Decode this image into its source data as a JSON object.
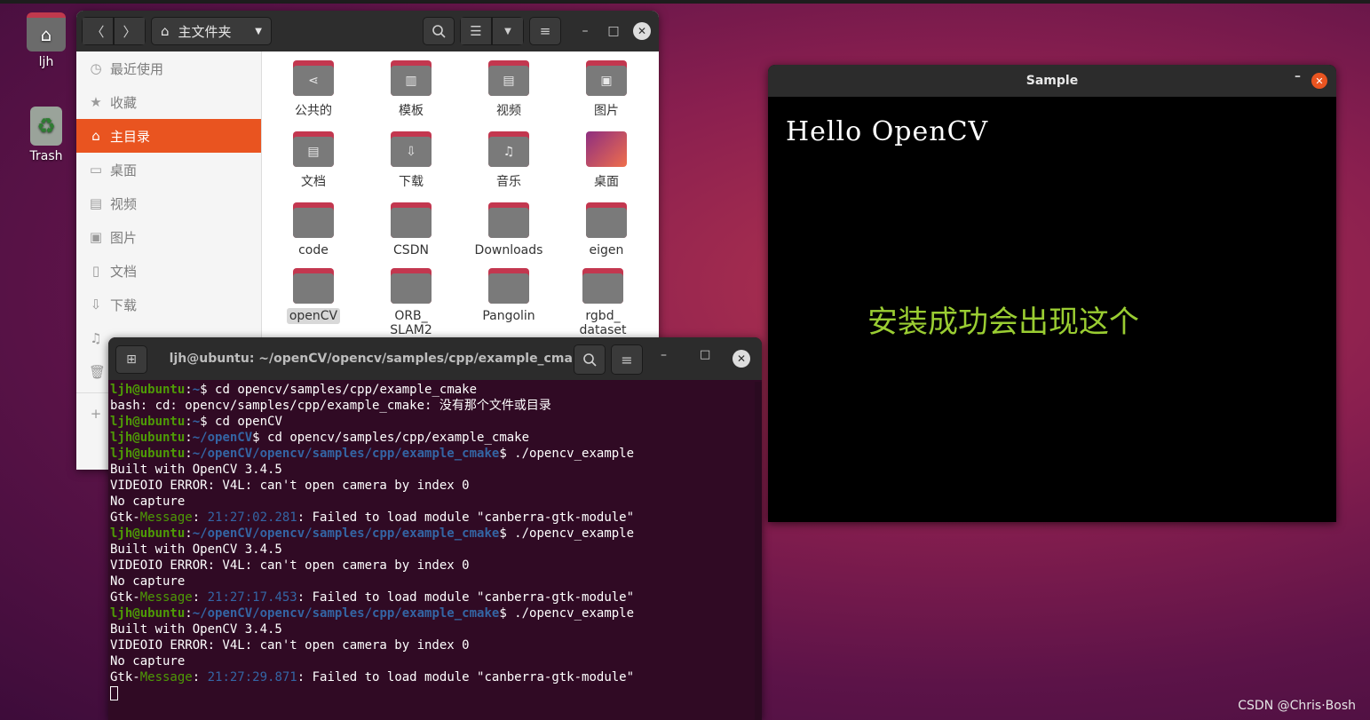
{
  "desktop": {
    "home_label": "ljh",
    "trash_label": "Trash"
  },
  "files": {
    "path_label": "主文件夹",
    "sidebar": [
      {
        "label": "最近使用",
        "icon": "clock-icon"
      },
      {
        "label": "收藏",
        "icon": "star-icon"
      },
      {
        "label": "主目录",
        "icon": "home-icon",
        "active": true
      },
      {
        "label": "桌面",
        "icon": "desktop-icon"
      },
      {
        "label": "视频",
        "icon": "video-icon"
      },
      {
        "label": "图片",
        "icon": "image-icon"
      },
      {
        "label": "文档",
        "icon": "document-icon"
      },
      {
        "label": "下载",
        "icon": "download-icon"
      }
    ],
    "items": [
      {
        "label": "公共的",
        "icon": "share-icon"
      },
      {
        "label": "模板",
        "icon": "template-icon"
      },
      {
        "label": "视频",
        "icon": "video-icon"
      },
      {
        "label": "图片",
        "icon": "image-icon"
      },
      {
        "label": "文档",
        "icon": "document-icon"
      },
      {
        "label": "下载",
        "icon": "download-icon"
      },
      {
        "label": "音乐",
        "icon": "music-icon"
      },
      {
        "label": "桌面",
        "icon": "desktop-icon"
      },
      {
        "label": "code",
        "icon": "folder-icon"
      },
      {
        "label": "CSDN",
        "icon": "folder-icon"
      },
      {
        "label": "Downloads",
        "icon": "folder-icon"
      },
      {
        "label": "eigen",
        "icon": "folder-icon"
      },
      {
        "label": "openCV",
        "icon": "folder-icon",
        "selected": true
      },
      {
        "label": "ORB_",
        "label2": "SLAM2",
        "icon": "folder-icon"
      },
      {
        "label": "Pangolin",
        "icon": "folder-icon"
      },
      {
        "label": "rgbd_",
        "label2": "dataset",
        "icon": "folder-icon"
      }
    ]
  },
  "sample": {
    "title": "Sample",
    "hello_text": "Hello OpenCV",
    "overlay_text": "安装成功会出现这个",
    "overlay_color": "#9acd32"
  },
  "terminal": {
    "title": "ljh@ubuntu: ~/openCV/opencv/samples/cpp/example_cmake",
    "lines": [
      {
        "user": "ljh@ubuntu",
        "path": "~",
        "cmd": " cd opencv/samples/cpp/example_cmake"
      },
      {
        "text": "bash: cd: opencv/samples/cpp/example_cmake: 没有那个文件或目录"
      },
      {
        "user": "ljh@ubuntu",
        "path": "~",
        "cmd": " cd openCV"
      },
      {
        "user": "ljh@ubuntu",
        "path": "~/openCV",
        "cmd": " cd opencv/samples/cpp/example_cmake"
      },
      {
        "user": "ljh@ubuntu",
        "path": "~/openCV/opencv/samples/cpp/example_cmake",
        "cmd": " ./opencv_example"
      },
      {
        "text": "Built with OpenCV 3.4.5"
      },
      {
        "text": "VIDEOIO ERROR: V4L: can't open camera by index 0"
      },
      {
        "text": "No capture"
      },
      {
        "gtk": "Gtk-",
        "msg": "Message",
        "time": "21:27:02.281",
        "rest": ": Failed to load module \"canberra-gtk-module\""
      },
      {
        "user": "ljh@ubuntu",
        "path": "~/openCV/opencv/samples/cpp/example_cmake",
        "cmd": " ./opencv_example"
      },
      {
        "text": "Built with OpenCV 3.4.5"
      },
      {
        "text": "VIDEOIO ERROR: V4L: can't open camera by index 0"
      },
      {
        "text": "No capture"
      },
      {
        "gtk": "Gtk-",
        "msg": "Message",
        "time": "21:27:17.453",
        "rest": ": Failed to load module \"canberra-gtk-module\""
      },
      {
        "user": "ljh@ubuntu",
        "path": "~/openCV/opencv/samples/cpp/example_cmake",
        "cmd": " ./opencv_example"
      },
      {
        "text": "Built with OpenCV 3.4.5"
      },
      {
        "text": "VIDEOIO ERROR: V4L: can't open camera by index 0"
      },
      {
        "text": "No capture"
      },
      {
        "gtk": "Gtk-",
        "msg": "Message",
        "time": "21:27:29.871",
        "rest": ": Failed to load module \"canberra-gtk-module\""
      }
    ]
  },
  "watermark": "CSDN @Chris·Bosh"
}
